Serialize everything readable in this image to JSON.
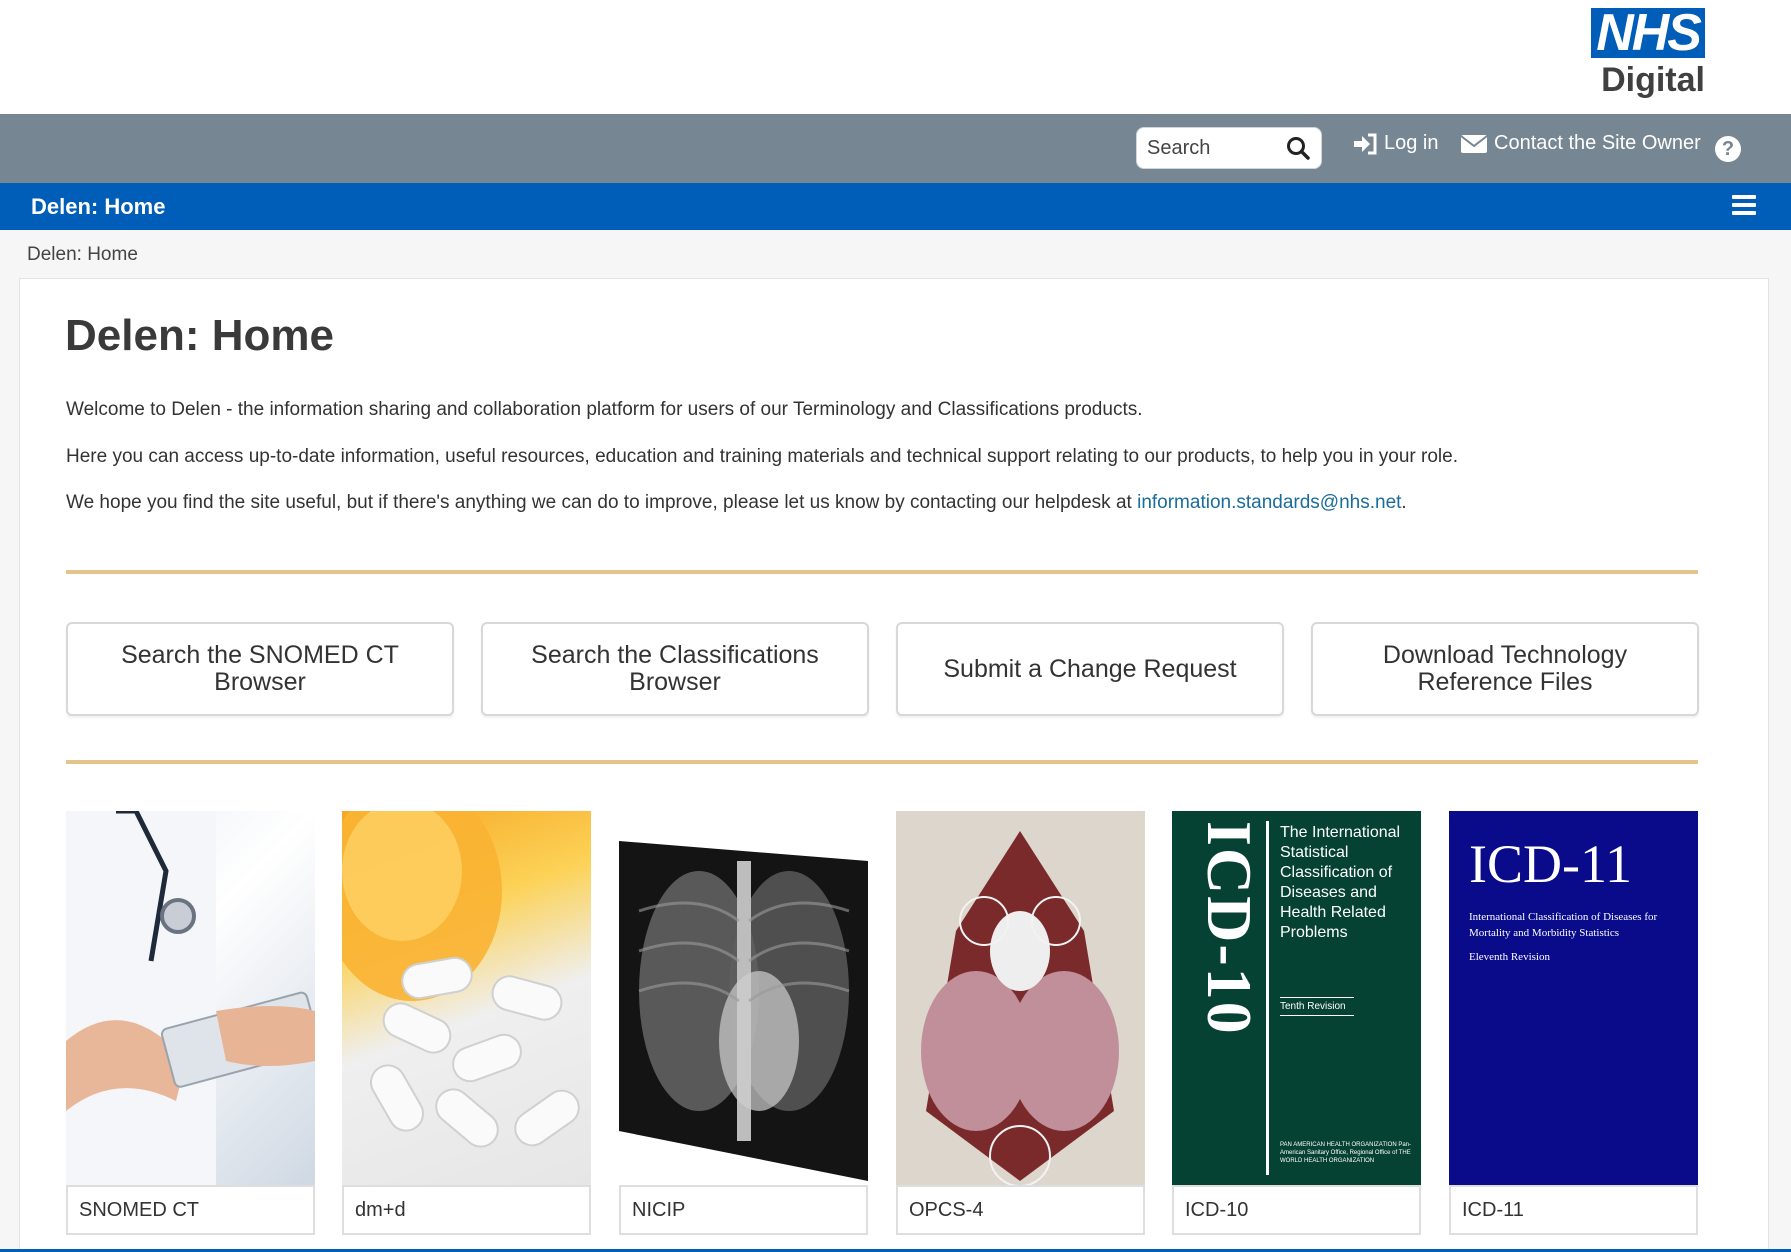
{
  "logo": {
    "brand": "NHS",
    "text": "Digital"
  },
  "toolbar": {
    "search_placeholder": "Search",
    "login_label": "Log in",
    "contact_label": "Contact the Site Owner",
    "help_label": "?"
  },
  "nav": {
    "title": "Delen: Home"
  },
  "breadcrumb": {
    "current": "Delen: Home"
  },
  "main": {
    "title": "Delen: Home",
    "para1": "Welcome to Delen - the information sharing and collaboration platform for users of our Terminology and Classifications products.",
    "para2": "Here you can access up-to-date information, useful resources, education and training materials and technical support relating to our products, to help you in your role.",
    "para3_prefix": "We hope you find the site useful, but if there's anything we can do to improve, please let us know by contacting our helpdesk at ",
    "para3_email": "information.standards@nhs.net",
    "para3_suffix": "."
  },
  "actions": [
    {
      "label": "Search the SNOMED CT Browser"
    },
    {
      "label": "Search the Classifications Browser"
    },
    {
      "label": "Submit a Change Request"
    },
    {
      "label": "Download Technology Reference Files"
    }
  ],
  "products": [
    {
      "label": "SNOMED CT"
    },
    {
      "label": "dm+d"
    },
    {
      "label": "NICIP"
    },
    {
      "label": "OPCS-4"
    },
    {
      "label": "ICD-10"
    },
    {
      "label": "ICD-11"
    }
  ],
  "icd10_cover": {
    "spine": "ICD-10",
    "text": "The International Statistical Classification of Diseases and Health Related Problems",
    "revision": "Tenth Revision",
    "publisher": "PAN AMERICAN HEALTH ORGANIZATION Pan-American Sanitary Office, Regional Office of THE WORLD HEALTH ORGANIZATION"
  },
  "icd11_cover": {
    "title": "ICD-11",
    "subtitle": "International Classification of Diseases for Mortality and Morbidity Statistics",
    "revision": "Eleventh Revision"
  },
  "colors": {
    "nhs_blue": "#005eb8",
    "toolbar_grey": "#768692",
    "divider_gold": "#e4c48a",
    "link_blue": "#1a6c9c"
  }
}
